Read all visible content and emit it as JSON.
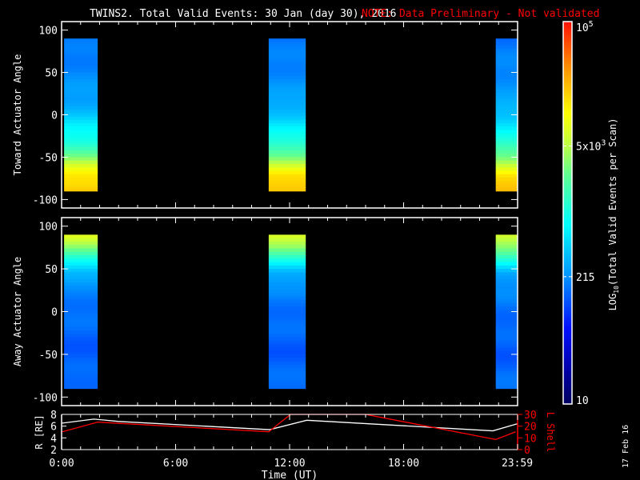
{
  "title": "TWINS2. Total Valid Events: 30 Jan (day  30), 2016",
  "note": "NOTE: Data Preliminary - Not validated",
  "stamp": "17 Feb 16",
  "colors": {
    "axis": "#ffffff",
    "note": "#ff0000",
    "lshell": "#ff0000",
    "r": "#ffffff"
  },
  "chart_data": [
    {
      "type": "heatmap",
      "panel": "toward",
      "ylabel": "Toward Actuator Angle",
      "ylim": [
        -110,
        110
      ],
      "yticks": [
        100,
        50,
        0,
        -50,
        -100
      ],
      "xlim_hours": [
        0,
        24
      ],
      "blocks": [
        {
          "start": 0.13,
          "end": 1.9
        },
        {
          "start": 10.9,
          "end": 12.85
        },
        {
          "start": 22.85,
          "end": 24
        }
      ],
      "angle_range": [
        -88,
        90
      ],
      "profile_angles": [
        90,
        50,
        20,
        0,
        -30,
        -50,
        -70,
        -88
      ],
      "profile_log10_counts": [
        2.2,
        2.3,
        2.4,
        2.6,
        3.0,
        3.5,
        4.1,
        4.3
      ]
    },
    {
      "type": "heatmap",
      "panel": "away",
      "ylabel": "Away Actuator Angle",
      "ylim": [
        -110,
        110
      ],
      "yticks": [
        100,
        50,
        0,
        -50,
        -100
      ],
      "xlim_hours": [
        0,
        24
      ],
      "blocks": [
        {
          "start": 0.13,
          "end": 1.9
        },
        {
          "start": 10.9,
          "end": 12.85
        },
        {
          "start": 22.85,
          "end": 24
        }
      ],
      "angle_range": [
        -88,
        90
      ],
      "profile_angles": [
        90,
        75,
        60,
        45,
        30,
        0,
        -50,
        -88
      ],
      "profile_log10_counts": [
        3.9,
        3.5,
        3.0,
        2.5,
        2.3,
        2.2,
        2.1,
        2.2
      ]
    },
    {
      "type": "line",
      "panel": "orbit",
      "ylabel": "R [RE]",
      "y2label": "L Shell",
      "ylim": [
        2,
        8
      ],
      "yticks": [
        2,
        4,
        6,
        8
      ],
      "y2lim": [
        0,
        30
      ],
      "y2ticks": [
        0,
        10,
        20,
        30
      ],
      "xlabel": "Time (UT)",
      "xticks": [
        {
          "h": 0,
          "label": "0:00"
        },
        {
          "h": 6,
          "label": "6:00"
        },
        {
          "h": 12,
          "label": "12:00"
        },
        {
          "h": 18,
          "label": "18:00"
        },
        {
          "h": 23.98,
          "label": "23:59"
        }
      ],
      "series": [
        {
          "name": "R",
          "axis": "left",
          "x": [
            0,
            1.7,
            3,
            10.95,
            12.9,
            22.7,
            23.98
          ],
          "y": [
            6.5,
            7.2,
            6.8,
            5.4,
            7.0,
            5.2,
            6.4
          ]
        },
        {
          "name": "L Shell",
          "axis": "right",
          "x": [
            0,
            1.9,
            10.9,
            12.05,
            16.0,
            22.85,
            23.9
          ],
          "y": [
            15,
            23.4,
            15.2,
            30,
            30,
            8.6,
            15.2
          ]
        }
      ]
    }
  ],
  "colorbar": {
    "title": "LOG10(Total Valid Events per Scan)",
    "title_main": "LOG",
    "title_sub": "10",
    "title_rest": "(Total Valid Events per Scan)",
    "range_log10": [
      1,
      5
    ],
    "ticks": [
      {
        "log10": 5,
        "base": "10",
        "exp": "5",
        "pre": ""
      },
      {
        "log10": 3.699,
        "base": "10",
        "exp": "3",
        "pre": "5x"
      },
      {
        "log10": 2.332,
        "label": "215"
      },
      {
        "log10": 1,
        "label": "10"
      }
    ]
  }
}
